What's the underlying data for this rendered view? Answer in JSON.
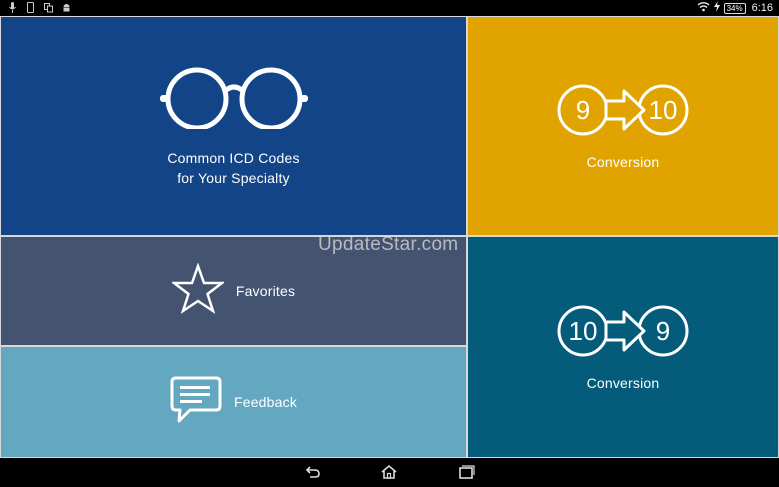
{
  "status_bar": {
    "battery": "34%",
    "time": "6:16"
  },
  "tiles": {
    "icd": {
      "label_line1": "Common ICD Codes",
      "label_line2": "for Your Specialty",
      "icon": "glasses-icon"
    },
    "conversion_9_10": {
      "label": "Conversion",
      "from": "9",
      "to": "10",
      "icon": "convert-9-to-10-icon"
    },
    "favorites": {
      "label": "Favorites",
      "icon": "star-icon"
    },
    "feedback": {
      "label": "Feedback",
      "icon": "chat-bubble-icon"
    },
    "conversion_10_9": {
      "label": "Conversion",
      "from": "10",
      "to": "9",
      "icon": "convert-10-to-9-icon"
    }
  },
  "watermark": "UpdateStar.com",
  "colors": {
    "icd": "#134487",
    "conversion_9_10": "#e0a300",
    "favorites": "#445370",
    "feedback": "#64a7c1",
    "conversion_10_9": "#045c7a"
  },
  "nav": {
    "back": "back-icon",
    "home": "home-icon",
    "recents": "recents-icon"
  }
}
